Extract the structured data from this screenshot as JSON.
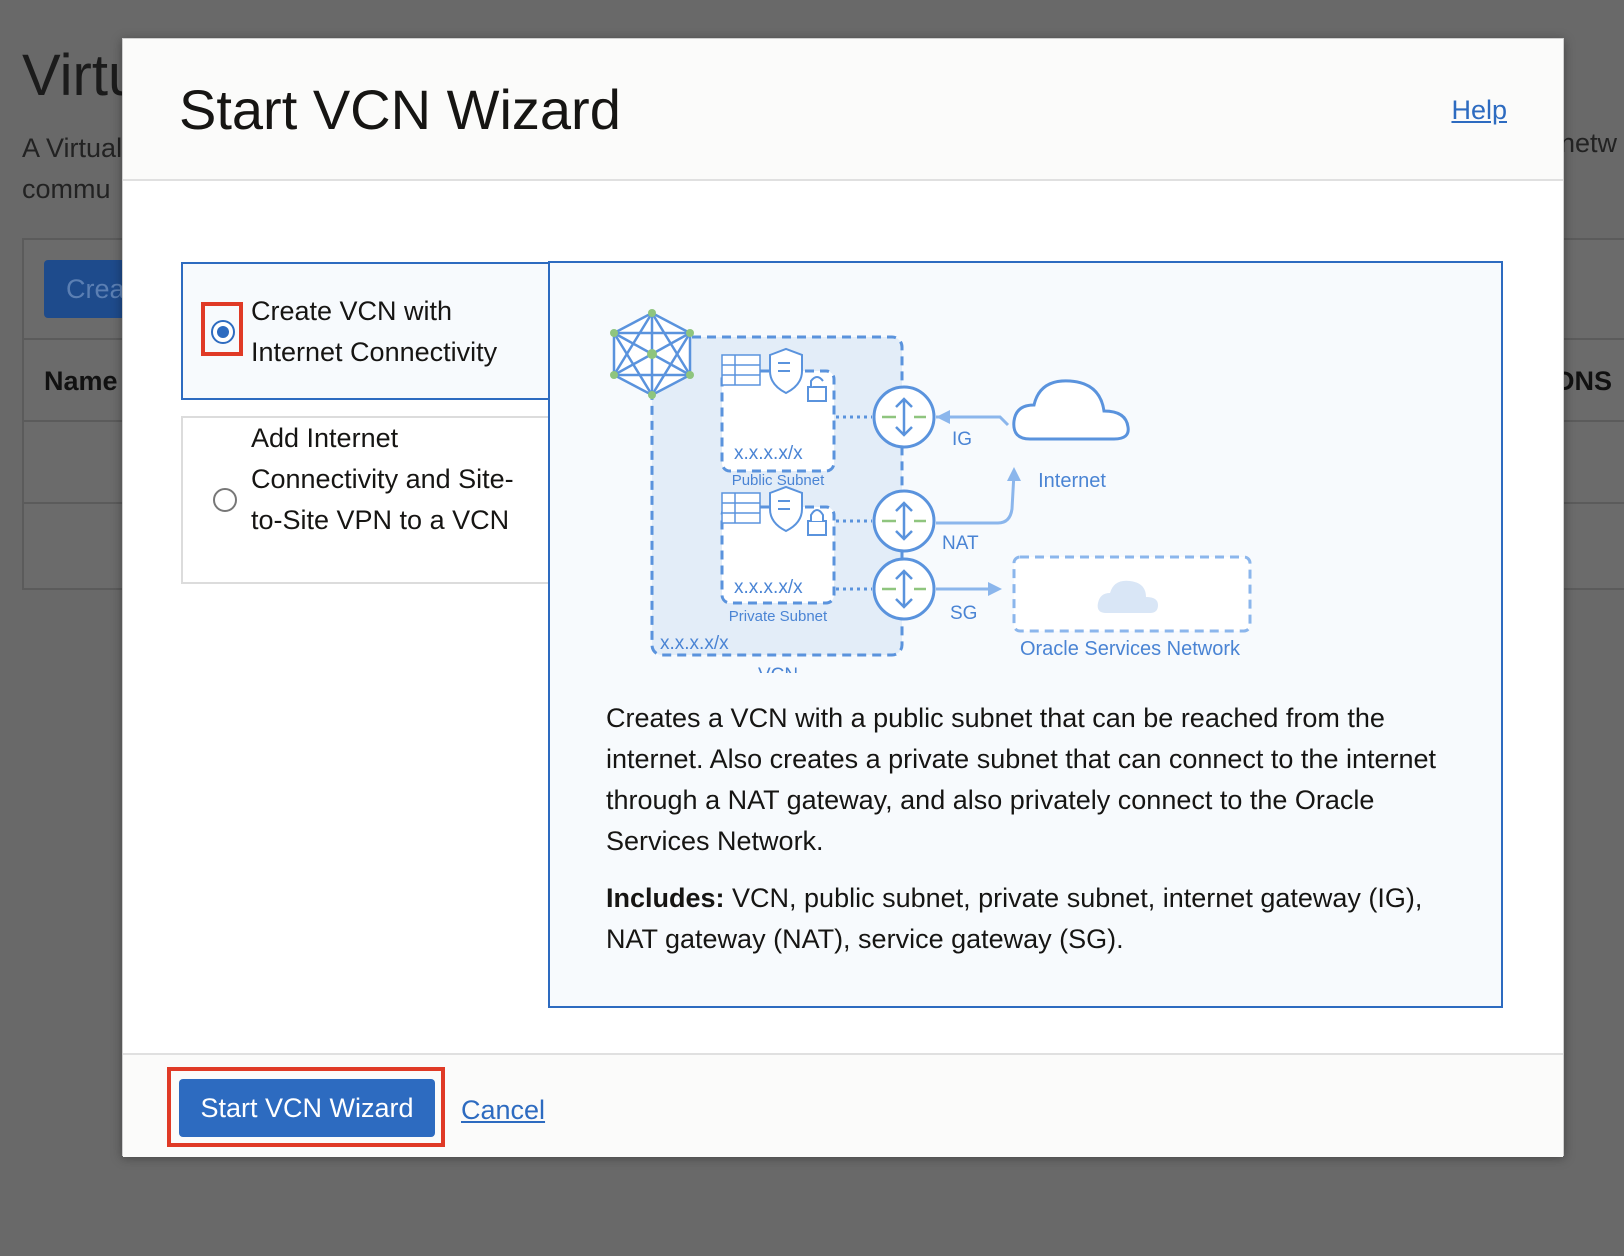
{
  "background": {
    "page_title": "Virtu",
    "description_line1": "A Virtual",
    "description_line2": "commu",
    "description_right": "netw",
    "create_button": "Crea",
    "column_name": "Name",
    "column_dns": "DNS I"
  },
  "modal": {
    "title": "Start VCN Wizard",
    "help_link": "Help",
    "options": [
      {
        "label": "Create VCN with Internet Connectivity",
        "selected": true
      },
      {
        "label": "Add Internet Connectivity and Site-to-Site VPN to a VCN",
        "selected": false
      }
    ],
    "diagram": {
      "public_subnet_cidr": "x.x.x.x/x",
      "public_subnet_label": "Public Subnet",
      "private_subnet_cidr": "x.x.x.x/x",
      "private_subnet_label": "Private Subnet",
      "vcn_cidr": "x.x.x.x/x",
      "vcn_label": "VCN",
      "ig_label": "IG",
      "nat_label": "NAT",
      "sg_label": "SG",
      "internet_label": "Internet",
      "osn_label": "Oracle Services Network"
    },
    "description": "Creates a VCN with a public subnet that can be reached from the internet. Also creates a private subnet that can connect to the internet through a NAT gateway, and also privately connect to the Oracle Services Network.",
    "includes_label": "Includes:",
    "includes_text": " VCN, public subnet, private subnet, internet gateway (IG), NAT gateway (NAT), service gateway (SG).",
    "primary_button": "Start VCN Wizard",
    "cancel_link": "Cancel"
  },
  "colors": {
    "accent": "#2d6bc0",
    "highlight": "#e03a26",
    "overlay": "#696969"
  }
}
